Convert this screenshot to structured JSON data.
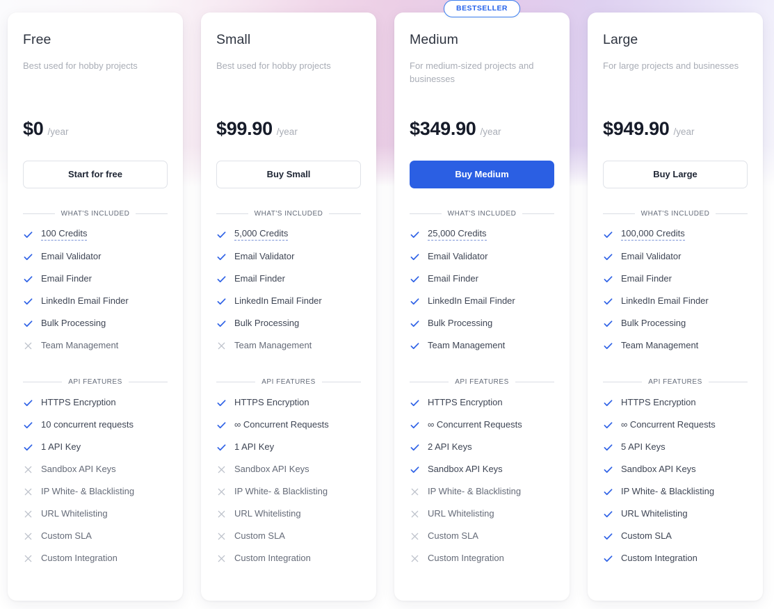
{
  "theme": {
    "accent_blue": "#2b5fe3",
    "check_blue": "#2f62e6",
    "cross_grey": "#bcc1ca",
    "text_dark": "#1d2433",
    "text_muted": "#a9adb6"
  },
  "badge": {
    "label": "BESTSELLER"
  },
  "sections": {
    "included_label": "WHAT'S INCLUDED",
    "api_label": "API FEATURES"
  },
  "plans": [
    {
      "id": "free",
      "name": "Free",
      "description": "Best used for hobby projects",
      "price": "$0",
      "period": "/year",
      "cta_label": "Start for free",
      "cta_style": "secondary",
      "highlighted": false,
      "included": [
        {
          "label": "100 Credits",
          "available": true,
          "tooltip": true
        },
        {
          "label": "Email Validator",
          "available": true,
          "tooltip": false
        },
        {
          "label": "Email Finder",
          "available": true,
          "tooltip": false
        },
        {
          "label": "LinkedIn Email Finder",
          "available": true,
          "tooltip": false
        },
        {
          "label": "Bulk Processing",
          "available": true,
          "tooltip": false
        },
        {
          "label": "Team Management",
          "available": false,
          "tooltip": false
        }
      ],
      "api_features": [
        {
          "label": "HTTPS Encryption",
          "available": true
        },
        {
          "label": "10 concurrent requests",
          "available": true
        },
        {
          "label": "1 API Key",
          "available": true
        },
        {
          "label": "Sandbox API Keys",
          "available": false
        },
        {
          "label": "IP White- & Blacklisting",
          "available": false
        },
        {
          "label": "URL Whitelisting",
          "available": false
        },
        {
          "label": "Custom SLA",
          "available": false
        },
        {
          "label": "Custom Integration",
          "available": false
        }
      ]
    },
    {
      "id": "small",
      "name": "Small",
      "description": "Best used for hobby projects",
      "price": "$99.90",
      "period": "/year",
      "cta_label": "Buy Small",
      "cta_style": "secondary",
      "highlighted": false,
      "included": [
        {
          "label": "5,000 Credits",
          "available": true,
          "tooltip": true
        },
        {
          "label": "Email Validator",
          "available": true,
          "tooltip": false
        },
        {
          "label": "Email Finder",
          "available": true,
          "tooltip": false
        },
        {
          "label": "LinkedIn Email Finder",
          "available": true,
          "tooltip": false
        },
        {
          "label": "Bulk Processing",
          "available": true,
          "tooltip": false
        },
        {
          "label": "Team Management",
          "available": false,
          "tooltip": false
        }
      ],
      "api_features": [
        {
          "label": "HTTPS Encryption",
          "available": true
        },
        {
          "label": "∞ Concurrent Requests",
          "available": true
        },
        {
          "label": "1 API Key",
          "available": true
        },
        {
          "label": "Sandbox API Keys",
          "available": false
        },
        {
          "label": "IP White- & Blacklisting",
          "available": false
        },
        {
          "label": "URL Whitelisting",
          "available": false
        },
        {
          "label": "Custom SLA",
          "available": false
        },
        {
          "label": "Custom Integration",
          "available": false
        }
      ]
    },
    {
      "id": "medium",
      "name": "Medium",
      "description": "For medium-sized projects and businesses",
      "price": "$349.90",
      "period": "/year",
      "cta_label": "Buy Medium",
      "cta_style": "primary",
      "highlighted": true,
      "included": [
        {
          "label": "25,000 Credits",
          "available": true,
          "tooltip": true
        },
        {
          "label": "Email Validator",
          "available": true,
          "tooltip": false
        },
        {
          "label": "Email Finder",
          "available": true,
          "tooltip": false
        },
        {
          "label": "LinkedIn Email Finder",
          "available": true,
          "tooltip": false
        },
        {
          "label": "Bulk Processing",
          "available": true,
          "tooltip": false
        },
        {
          "label": "Team Management",
          "available": true,
          "tooltip": false
        }
      ],
      "api_features": [
        {
          "label": "HTTPS Encryption",
          "available": true
        },
        {
          "label": "∞ Concurrent Requests",
          "available": true
        },
        {
          "label": "2 API Keys",
          "available": true
        },
        {
          "label": "Sandbox API Keys",
          "available": true
        },
        {
          "label": "IP White- & Blacklisting",
          "available": false
        },
        {
          "label": "URL Whitelisting",
          "available": false
        },
        {
          "label": "Custom SLA",
          "available": false
        },
        {
          "label": "Custom Integration",
          "available": false
        }
      ]
    },
    {
      "id": "large",
      "name": "Large",
      "description": "For large projects and businesses",
      "price": "$949.90",
      "period": "/year",
      "cta_label": "Buy Large",
      "cta_style": "secondary",
      "highlighted": false,
      "included": [
        {
          "label": "100,000 Credits",
          "available": true,
          "tooltip": true
        },
        {
          "label": "Email Validator",
          "available": true,
          "tooltip": false
        },
        {
          "label": "Email Finder",
          "available": true,
          "tooltip": false
        },
        {
          "label": "LinkedIn Email Finder",
          "available": true,
          "tooltip": false
        },
        {
          "label": "Bulk Processing",
          "available": true,
          "tooltip": false
        },
        {
          "label": "Team Management",
          "available": true,
          "tooltip": false
        }
      ],
      "api_features": [
        {
          "label": "HTTPS Encryption",
          "available": true
        },
        {
          "label": "∞ Concurrent Requests",
          "available": true
        },
        {
          "label": "5 API Keys",
          "available": true
        },
        {
          "label": "Sandbox API Keys",
          "available": true
        },
        {
          "label": "IP White- & Blacklisting",
          "available": true
        },
        {
          "label": "URL Whitelisting",
          "available": true
        },
        {
          "label": "Custom SLA",
          "available": true
        },
        {
          "label": "Custom Integration",
          "available": true
        }
      ]
    }
  ]
}
